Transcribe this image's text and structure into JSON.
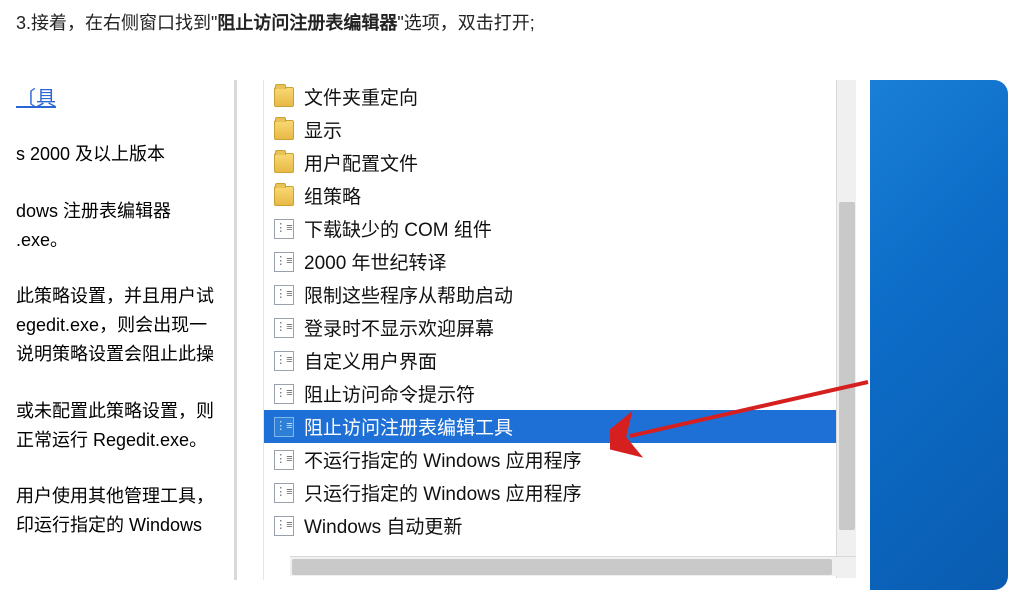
{
  "instruction": {
    "prefix": "3.接着，在右侧窗口找到\"",
    "bold": "阻止访问注册表编辑器",
    "suffix": "\"选项，双击打开;"
  },
  "link_fragment": "〔具",
  "left_col": {
    "p1": "s 2000 及以上版本",
    "p2": "dows 注册表编辑器 .exe。",
    "p3": "此策略设置，并且用户试 egedit.exe，则会出现一 说明策略设置会阻止此操",
    "p4": "或未配置此策略设置，则 正常运行 Regedit.exe。",
    "p5": "用户使用其他管理工具， 印运行指定的 Windows"
  },
  "list": {
    "items": [
      {
        "type": "folder",
        "label": "文件夹重定向"
      },
      {
        "type": "folder",
        "label": "显示"
      },
      {
        "type": "folder",
        "label": "用户配置文件"
      },
      {
        "type": "folder",
        "label": "组策略"
      },
      {
        "type": "setting",
        "label": "下载缺少的 COM 组件"
      },
      {
        "type": "setting",
        "label": "2000 年世纪转译"
      },
      {
        "type": "setting",
        "label": "限制这些程序从帮助启动"
      },
      {
        "type": "setting",
        "label": "登录时不显示欢迎屏幕"
      },
      {
        "type": "setting",
        "label": "自定义用户界面"
      },
      {
        "type": "setting",
        "label": "阻止访问命令提示符"
      },
      {
        "type": "setting",
        "label": "阻止访问注册表编辑工具",
        "selected": true
      },
      {
        "type": "setting",
        "label": "不运行指定的 Windows 应用程序"
      },
      {
        "type": "setting",
        "label": "只运行指定的 Windows 应用程序"
      },
      {
        "type": "setting",
        "label": "Windows 自动更新"
      }
    ]
  }
}
